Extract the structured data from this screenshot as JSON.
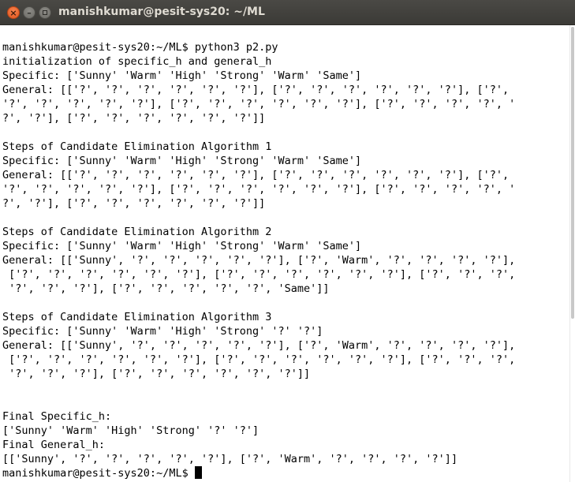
{
  "window": {
    "title": "manishkumar@pesit-sys20: ~/ML",
    "close_glyph": "×",
    "minimize_glyph": "–",
    "colors": {
      "titlebar": "#3c3b37",
      "close": "#e95b22",
      "terminal_bg": "#ffffff",
      "text": "#000000"
    },
    "icons": {
      "close": "close-icon",
      "minimize": "minimize-icon",
      "maximize": "maximize-icon"
    }
  },
  "terminal": {
    "lines": [
      "manishkumar@pesit-sys20:~/ML$ python3 p2.py",
      "initialization of specific_h and general_h",
      "Specific: ['Sunny' 'Warm' 'High' 'Strong' 'Warm' 'Same']",
      "General: [['?', '?', '?', '?', '?', '?'], ['?', '?', '?', '?', '?', '?'], ['?',",
      "'?', '?', '?', '?', '?'], ['?', '?', '?', '?', '?', '?'], ['?', '?', '?', '?', '",
      "?', '?'], ['?', '?', '?', '?', '?', '?']]",
      "",
      "Steps of Candidate Elimination Algorithm 1",
      "Specific: ['Sunny' 'Warm' 'High' 'Strong' 'Warm' 'Same']",
      "General: [['?', '?', '?', '?', '?', '?'], ['?', '?', '?', '?', '?', '?'], ['?',",
      "'?', '?', '?', '?', '?'], ['?', '?', '?', '?', '?', '?'], ['?', '?', '?', '?', '",
      "?', '?'], ['?', '?', '?', '?', '?', '?']]",
      "",
      "Steps of Candidate Elimination Algorithm 2",
      "Specific: ['Sunny' 'Warm' 'High' 'Strong' 'Warm' 'Same']",
      "General: [['Sunny', '?', '?', '?', '?', '?'], ['?', 'Warm', '?', '?', '?', '?'],",
      " ['?', '?', '?', '?', '?', '?'], ['?', '?', '?', '?', '?', '?'], ['?', '?', '?',",
      " '?', '?', '?'], ['?', '?', '?', '?', '?', 'Same']]",
      "",
      "Steps of Candidate Elimination Algorithm 3",
      "Specific: ['Sunny' 'Warm' 'High' 'Strong' '?' '?']",
      "General: [['Sunny', '?', '?', '?', '?', '?'], ['?', 'Warm', '?', '?', '?', '?'],",
      " ['?', '?', '?', '?', '?', '?'], ['?', '?', '?', '?', '?', '?'], ['?', '?', '?',",
      " '?', '?', '?'], ['?', '?', '?', '?', '?', '?']]",
      "",
      "",
      "Final Specific_h:",
      "['Sunny' 'Warm' 'High' 'Strong' '?' '?']",
      "Final General_h:",
      "[['Sunny', '?', '?', '?', '?', '?'], ['?', 'Warm', '?', '?', '?', '?']]"
    ],
    "prompt": "manishkumar@pesit-sys20:~/ML$"
  }
}
